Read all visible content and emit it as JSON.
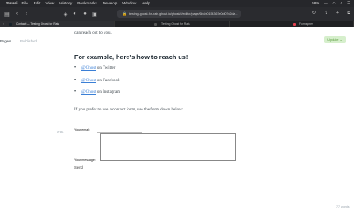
{
  "menubar": {
    "app": "Safari",
    "items": [
      "File",
      "Edit",
      "View",
      "History",
      "Bookmarks",
      "Develop",
      "Window",
      "Help"
    ],
    "battery": "68%"
  },
  "browser": {
    "url": "testing-ghost-for-rats.ghost.io/ghost/#/editor/page/6b4b0154367e0d07b2da..."
  },
  "tabs": [
    {
      "label": "Contact — Testing Ghost for Rats",
      "active": true
    },
    {
      "label": "Testing Ghost for Rats",
      "active": false
    },
    {
      "label": "Formspree",
      "active": false
    }
  ],
  "editor": {
    "breadcrumb": "Pages",
    "status": "Published",
    "update_label": "Update",
    "intro_text": "can reach out to you.",
    "heading": "For example, here's how to reach us!",
    "contacts": [
      {
        "handle": "@Ghost",
        "platform": "on Twitter"
      },
      {
        "handle": "@Ghost",
        "platform": "on Facebook"
      },
      {
        "handle": "@Ghost",
        "platform": "on Instagram"
      }
    ],
    "form_intro": "If you prefer to use a contact form, use the form down below:",
    "card_marker": "HTML",
    "form": {
      "email_label": "Your email:",
      "message_label": "Your message:",
      "send_label": "Send"
    },
    "word_count": "77 words"
  }
}
